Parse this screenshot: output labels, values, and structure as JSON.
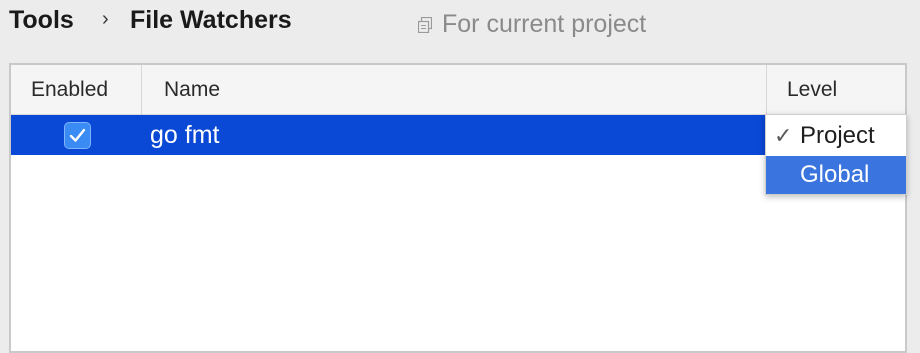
{
  "breadcrumb": {
    "parent": "Tools",
    "separator": "›",
    "current": "File Watchers"
  },
  "scope_label": "For current project",
  "icons": {
    "scope": "copy-stack-icon",
    "check": "checkmark-icon"
  },
  "table": {
    "columns": [
      "Enabled",
      "Name",
      "Level"
    ],
    "rows": [
      {
        "enabled": true,
        "name": "go fmt"
      }
    ]
  },
  "level_dropdown": {
    "options": [
      "Project",
      "Global"
    ],
    "selected": "Project",
    "highlighted": "Global",
    "check_glyph": "✓"
  },
  "colors": {
    "selection": "#0a48d6",
    "highlight": "#3a74de",
    "checkbox": "#3b8bf4"
  }
}
